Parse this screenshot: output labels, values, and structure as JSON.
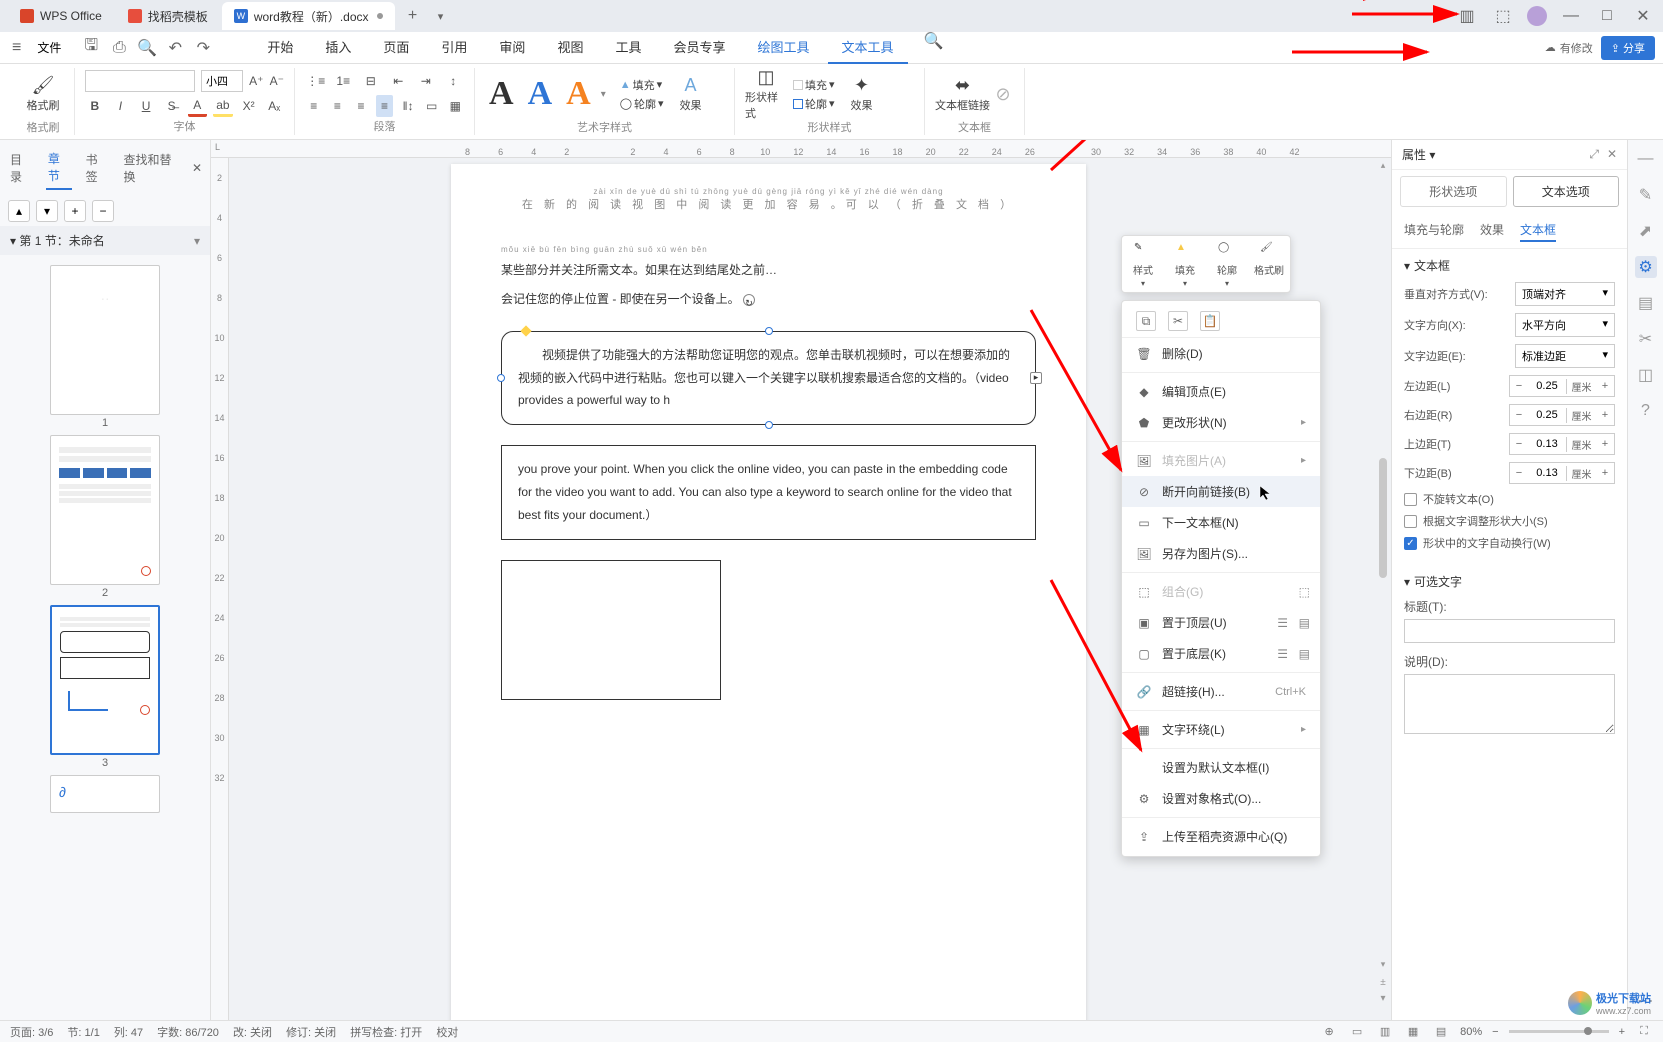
{
  "titlebar": {
    "tabs": [
      {
        "label": "WPS Office",
        "type": "app",
        "color": "#d9452a"
      },
      {
        "label": "找稻壳模板",
        "type": "template",
        "color": "#ffffff",
        "bg": "#e74e3d"
      },
      {
        "label": "word教程（新）.docx",
        "type": "doc",
        "color": "#2e6fd1",
        "modified": true
      }
    ],
    "window_buttons": {
      "min": "—",
      "max": "□",
      "close": "✕"
    }
  },
  "menubar": {
    "file": "文件",
    "tabs": [
      "开始",
      "插入",
      "页面",
      "引用",
      "审阅",
      "视图",
      "工具",
      "会员专享",
      "绘图工具",
      "文本工具"
    ],
    "active_tab": "文本工具",
    "context_tabs": [
      "绘图工具",
      "文本工具"
    ],
    "cloud_status": "有修改",
    "share": "分享"
  },
  "ribbon": {
    "group1": {
      "brush": "格式刷",
      "label": "格式刷"
    },
    "group2": {
      "font_name": "",
      "font_size": "小四",
      "label": "字体"
    },
    "group3": {
      "label": "段落"
    },
    "group4": {
      "label": "艺术字样式",
      "fill": "填充",
      "outline": "轮廓",
      "effects": "效果"
    },
    "group5": {
      "label": "形状样式",
      "style": "形状样式",
      "fill": "填充",
      "outline": "轮廓",
      "effects": "效果"
    },
    "group6": {
      "link": "文本框链接",
      "label": "文本框"
    }
  },
  "nav": {
    "tabs": [
      "目录",
      "章节",
      "书签",
      "查找和替换"
    ],
    "active": "章节",
    "section_title": "第 1 节：未命名",
    "thumb_count": 3,
    "selected_thumb": 3
  },
  "ruler_h": [
    "8",
    "6",
    "4",
    "2",
    "",
    "2",
    "4",
    "6",
    "8",
    "10",
    "12",
    "14",
    "16",
    "18",
    "20",
    "22",
    "24",
    "26",
    "",
    "30",
    "32",
    "34",
    "36",
    "38",
    "40",
    "42",
    ""
  ],
  "ruler_v": [
    "",
    "2",
    "4",
    "6",
    "8",
    "10",
    "12",
    "14",
    "16",
    "18",
    "20",
    "22",
    "24",
    "26",
    "28",
    "30",
    "32"
  ],
  "document": {
    "header_pinyin": "zài xīn de yuè dú shì tú zhōng yuè dú gèng jiā róng yì     kě yǐ     zhé dié wén dàng",
    "header_line": "在 新 的 阅 读 视 图 中 阅 读 更 加 容 易 。可 以 （ 折 叠 文 档 ）",
    "para1_pinyin": "mǒu xiē bù fēn bìng guān zhù suǒ xū wén běn",
    "para1": "某些部分并关注所需文本。如果在达到结尾处之前…",
    "para2": "会记住您的停止位置 - 即使在另一个设备上。",
    "tb1": "　　视频提供了功能强大的方法帮助您证明您的观点。您单击联机视频时，可以在想要添加的视频的嵌入代码中进行粘贴。您也可以键入一个关键字以联机搜索最适合您的文档的。（video provides a powerful way to h",
    "tb2": "you prove your point. When you click the online video, you can paste in the embedding code for the video you want to add. You can also type a keyword to search online for the video that best fits your document.）"
  },
  "mini_toolbar": {
    "items": [
      {
        "label": "样式",
        "icon": "pen"
      },
      {
        "label": "填充",
        "icon": "bucket",
        "color": "#f7c948"
      },
      {
        "label": "轮廓",
        "icon": "outline"
      },
      {
        "label": "格式刷",
        "icon": "brush"
      }
    ]
  },
  "context_menu": {
    "clipboard": [
      "copy",
      "cut",
      "paste"
    ],
    "items": [
      {
        "label": "删除(D)",
        "icon": "trash"
      },
      {
        "label": "编辑顶点(E)",
        "icon": "vertex"
      },
      {
        "label": "更改形状(N)",
        "icon": "shape",
        "submenu": true
      },
      {
        "label": "填充图片(A)",
        "icon": "image",
        "submenu": true,
        "disabled": true
      },
      {
        "label": "断开向前链接(B)",
        "icon": "unlink",
        "highlighted": true
      },
      {
        "label": "下一文本框(N)",
        "icon": "next-textbox"
      },
      {
        "label": "另存为图片(S)...",
        "icon": "save-image"
      },
      {
        "label": "组合(G)",
        "icon": "group",
        "disabled": true,
        "trailing": true
      },
      {
        "label": "置于顶层(U)",
        "icon": "front",
        "trailing": true,
        "trailing2": true
      },
      {
        "label": "置于底层(K)",
        "icon": "back",
        "trailing": true,
        "trailing2": true
      },
      {
        "label": "超链接(H)...",
        "icon": "link",
        "shortcut": "Ctrl+K"
      },
      {
        "label": "文字环绕(L)",
        "icon": "wrap",
        "submenu": true
      },
      {
        "label": "设置为默认文本框(I)",
        "icon": ""
      },
      {
        "label": "设置对象格式(O)...",
        "icon": "format"
      },
      {
        "label": "上传至稻壳资源中心(Q)",
        "icon": "upload"
      }
    ]
  },
  "properties": {
    "title": "属性",
    "main_tabs": [
      "形状选项",
      "文本选项"
    ],
    "active_main": "文本选项",
    "sub_tabs": [
      "填充与轮廓",
      "效果",
      "文本框"
    ],
    "active_sub": "文本框",
    "section1_title": "文本框",
    "rows": {
      "valign": {
        "label": "垂直对齐方式(V):",
        "value": "顶端对齐"
      },
      "direction": {
        "label": "文字方向(X):",
        "value": "水平方向"
      },
      "margin": {
        "label": "文字边距(E):",
        "value": "标准边距"
      },
      "left": {
        "label": "左边距(L)",
        "value": "0.25",
        "unit": "厘米"
      },
      "right": {
        "label": "右边距(R)",
        "value": "0.25",
        "unit": "厘米"
      },
      "top": {
        "label": "上边距(T)",
        "value": "0.13",
        "unit": "厘米"
      },
      "bottom": {
        "label": "下边距(B)",
        "value": "0.13",
        "unit": "厘米"
      }
    },
    "checks": {
      "no_rotate": {
        "label": "不旋转文本(O)",
        "checked": false
      },
      "resize": {
        "label": "根据文字调整形状大小(S)",
        "checked": false
      },
      "wrap": {
        "label": "形状中的文字自动换行(W)",
        "checked": true
      }
    },
    "section2_title": "可选文字",
    "title_label": "标题(T):",
    "desc_label": "说明(D):"
  },
  "statusbar": {
    "page": "页面: 3/6",
    "section": "节: 1/1",
    "column": "列: 47",
    "words": "字数: 86/720",
    "track": "改: 关闭",
    "revise": "修订: 关闭",
    "spell": "拼写检查: 打开",
    "proof": "校对",
    "zoom": "80%"
  },
  "watermark": {
    "site_ch": "极光下载站",
    "site_url": "www.xz7.com"
  }
}
